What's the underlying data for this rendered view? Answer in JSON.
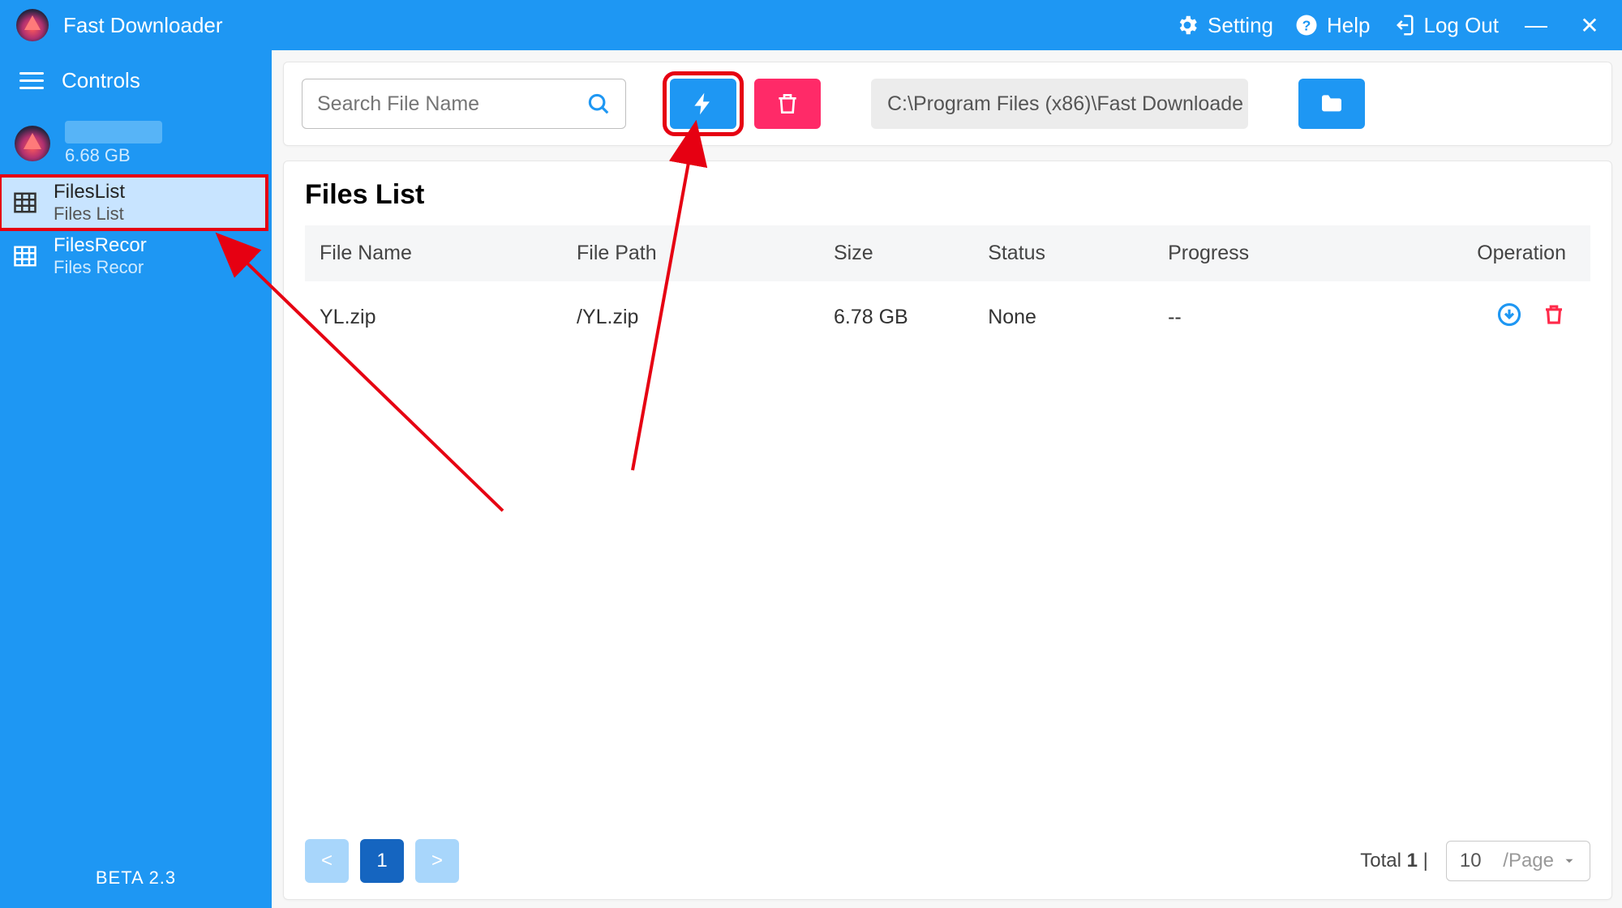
{
  "titlebar": {
    "app_name": "Fast Downloader",
    "setting": "Setting",
    "help": "Help",
    "logout": "Log Out"
  },
  "sidebar": {
    "controls": "Controls",
    "account_size": "6.68 GB",
    "items": [
      {
        "title": "FilesList",
        "subtitle": "Files List"
      },
      {
        "title": "FilesRecor",
        "subtitle": "Files Recor"
      }
    ],
    "version": "BETA 2.3"
  },
  "toolbar": {
    "search_placeholder": "Search File Name",
    "path": "C:\\Program Files (x86)\\Fast Downloade"
  },
  "files": {
    "heading": "Files List",
    "columns": {
      "name": "File Name",
      "path": "File Path",
      "size": "Size",
      "status": "Status",
      "progress": "Progress",
      "op": "Operation"
    },
    "rows": [
      {
        "name": "YL.zip",
        "path": "/YL.zip",
        "size": "6.78 GB",
        "status": "None",
        "progress": "--"
      }
    ]
  },
  "pager": {
    "prev": "<",
    "page": "1",
    "next": ">",
    "total_label": "Total",
    "total": "1",
    "sep": "|",
    "pagesize": "10",
    "per": "/Page"
  }
}
